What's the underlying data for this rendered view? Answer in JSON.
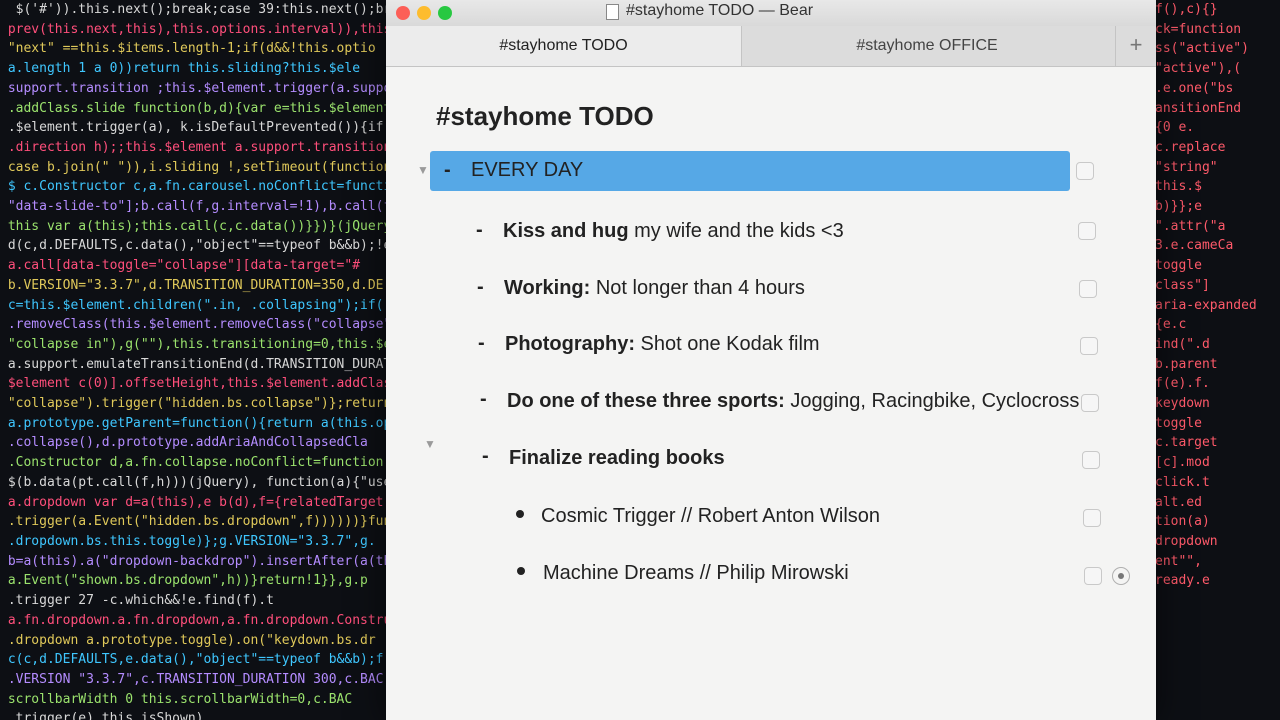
{
  "code_left": [
    "  $('#')).this.next();break;case 39:this.next();break;",
    " prev(this.next,this),this.options.interval)),this},",
    " \"next\" ==this.$items.length-1;if(d&&!this.optio",
    " a.length 1 a 0))return this.sliding?this.$ele",
    " support.transition ;this.$element.trigger(a.support.t",
    " .addClass.slide function(b,d){var e=this.$element.fi",
    " .$element.trigger(a), k.isDefaultPrevented()){if(this.sl",
    " .direction h);;this.$element a.support.transition&&this.",
    " case b.join(\" \")),i.sliding !,setTimeout(function(",
    " $ c.Constructor c,a.fn.carousel.noConflict=function(",
    " \"data-slide-to\"];b.call(f,g.interval=!1),b.call(f,g),h&&f",
    " this var a(this);this.call(c,c.data())}})}(jQuery),+fu",
    " d(c,d.DEFAULTS,c.data(),\"object\"==typeof b&&b);!e&&",
    " a.call[data-toggle=\"collapse\"][data-target=\"#",
    " b.VERSION=\"3.3.7\",d.TRANSITION_DURATION=350,d.DE",
    " c=this.$element.children(\".in, .collapsing\");if(!(e&&e.",
    " .removeClass(this.$element.removeClass(\"collapse\").addCl",
    " \"collapse in\"),g(\"\"),this.transitioning=0,this.$e",
    " a.support.emulateTransitionEnd(d.TRANSITION_DURATION)[g]",
    " $element c(0)].offsetHeight,this.$element.addClass",
    " \"collapse\").trigger(\"hidden.bs.collapse\")};return",
    " a.prototype.getParent=function(){return a(this.optio",
    " .collapse(),d.prototype.addAriaAndCollapsedCla",
    " .Constructor d,a.fn.collapse.noConflict=function(",
    " $(b.data(pt.call(f,h)))(jQuery), function(a){\"use",
    " a.dropdown var d=a(this),e b(d),f={relatedTarget:thi",
    " .trigger(a.Event(\"hidden.bs.dropdown\",f))))))}functi",
    " .dropdown.bs.this.toggle)};g.VERSION=\"3.3.7\",g.",
    " b=a(this).a(\"dropdown-backdrop\").insertAfter(a(thi",
    " a.Event(\"shown.bs.dropdown\",h))}return!1}},g.p",
    " .trigger 27 -c.which&&!e.find(f).t",
    " a.fn.dropdown.a.fn.dropdown,a.fn.dropdown.Construct",
    " .dropdown a.prototype.toggle).on(\"keydown.bs.dr",
    " c(c,d.DEFAULTS,e.data(),\"object\"==typeof b&&b);f||e.d",
    " .VERSION \"3.3.7\",c.TRANSITION_DURATION 300,c.BAC",
    " scrollbarWidth 0 this.scrollbarWidth=0,c.BAC",
    " .trigger(e),this.isShown)"
  ],
  "code_right": [
    "f(),c){}",
    "ck=function",
    "ss(\"active\")",
    "\"active\"),(",
    ".e.one(\"bs",
    "ansitionEnd",
    "{0 e.",
    "c.replace",
    "\"string\"",
    "this.$",
    "b)}};e",
    "\".attr(\"a",
    "3.e.cameCa",
    "toggle",
    "class\"]",
    "aria-expanded",
    "{e.c",
    "ind(\".d",
    "b.parent",
    "f(e).f.",
    "keydown",
    "toggle",
    "c.target",
    "[c].mod",
    "click.t",
    "alt.ed",
    "tion(a)",
    "dropdown",
    "ent\"\",",
    "ready.e"
  ],
  "window": {
    "title": "#stayhome TODO — Bear",
    "tabs": [
      "#stayhome TODO",
      "#stayhome OFFICE"
    ],
    "add_tab_label": "+"
  },
  "doc": {
    "title": "#stayhome TODO",
    "items": [
      {
        "type": "header",
        "text": "EVERY DAY"
      },
      {
        "type": "task",
        "bold": "Kiss and hug",
        "rest": " my wife and the kids <3"
      },
      {
        "type": "task",
        "bold": "Working:",
        "rest": " Not longer than 4 hours"
      },
      {
        "type": "task",
        "bold": "Photography:",
        "rest": " Shot one Kodak film"
      },
      {
        "type": "task",
        "bold": "Do one of these three sports:",
        "rest": " Jogging, Racingbike, Cyclocross"
      },
      {
        "type": "task",
        "bold": "Finalize reading books",
        "rest": ""
      },
      {
        "type": "bullet",
        "text": "Cosmic Trigger // Robert Anton Wilson"
      },
      {
        "type": "bullet",
        "text": "Machine Dreams // Philip Mirowski"
      }
    ],
    "dash_glyph": "-",
    "fold_glyph": "▼"
  }
}
